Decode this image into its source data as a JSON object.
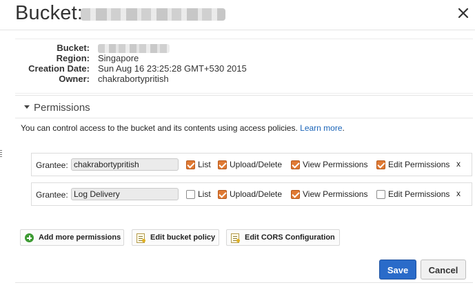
{
  "header": {
    "title_prefix": "Bucket:",
    "close_icon": "close-icon"
  },
  "properties": [
    {
      "key": "Bucket:",
      "value": ""
    },
    {
      "key": "Region:",
      "value": "Singapore"
    },
    {
      "key": "Creation Date:",
      "value": "Sun Aug 16 23:25:28 GMT+530 2015"
    },
    {
      "key": "Owner:",
      "value": "chakrabortypritish"
    }
  ],
  "permissions": {
    "section_title": "Permissions",
    "expanded": true,
    "description": "You can control access to the bucket and its contents using access policies.",
    "learn_more": "Learn more",
    "description_end": ".",
    "grantee_label": "Grantee:",
    "remove_label": "x",
    "grants": [
      {
        "grantee": "chakrabortypritish",
        "list": {
          "label": "List",
          "checked": true
        },
        "upload_delete": {
          "label": "Upload/Delete",
          "checked": true
        },
        "view_permissions": {
          "label": "View Permissions",
          "checked": true
        },
        "edit_permissions": {
          "label": "Edit Permissions",
          "checked": true
        }
      },
      {
        "grantee": "Log Delivery",
        "list": {
          "label": "List",
          "checked": false
        },
        "upload_delete": {
          "label": "Upload/Delete",
          "checked": true
        },
        "view_permissions": {
          "label": "View Permissions",
          "checked": true
        },
        "edit_permissions": {
          "label": "Edit Permissions",
          "checked": false
        }
      }
    ]
  },
  "actions": {
    "add_more": "Add more permissions",
    "edit_policy": "Edit bucket policy",
    "edit_cors": "Edit CORS Configuration"
  },
  "footer": {
    "save": "Save",
    "cancel": "Cancel"
  },
  "colors": {
    "accent_blue": "#2a6bc9",
    "checkbox_orange": "#e07a34",
    "add_green": "#3c9a32",
    "link_blue": "#1a64b8"
  }
}
